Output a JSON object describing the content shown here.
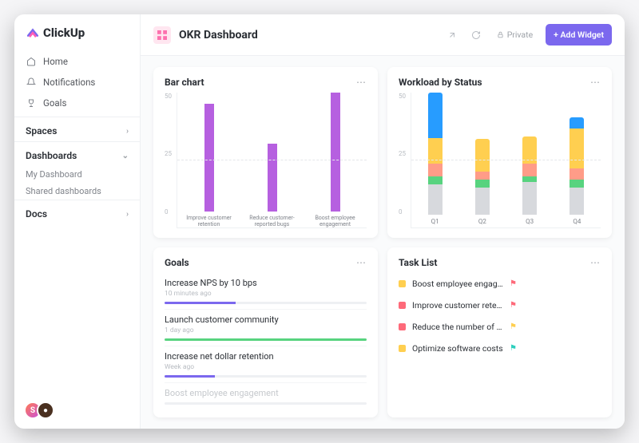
{
  "brand": "ClickUp",
  "sidebar": {
    "home": "Home",
    "notifications": "Notifications",
    "goals": "Goals",
    "spaces": {
      "label": "Spaces"
    },
    "dashboards": {
      "label": "Dashboards",
      "items": [
        "My Dashboard",
        "Shared dashboards"
      ]
    },
    "docs": {
      "label": "Docs"
    }
  },
  "header": {
    "title": "OKR Dashboard",
    "private": "Private",
    "add_widget": "+ Add Widget"
  },
  "cards": {
    "bar_chart": {
      "title": "Bar chart"
    },
    "workload": {
      "title": "Workload by Status"
    },
    "goals": {
      "title": "Goals",
      "items": [
        {
          "title": "Increase NPS by 10 bps",
          "sub": "10 minutes ago",
          "pct": 35,
          "color": "#7b68ee"
        },
        {
          "title": "Launch customer community",
          "sub": "1 day ago",
          "pct": 100,
          "color": "#58d37f"
        },
        {
          "title": "Increase net dollar retention",
          "sub": "Week ago",
          "pct": 25,
          "color": "#7b68ee"
        },
        {
          "title": "Boost employee engagement",
          "sub": "",
          "pct": 0,
          "color": "#c6c9cd",
          "faded": true
        }
      ]
    },
    "tasklist": {
      "title": "Task List",
      "items": [
        {
          "color": "#ffcf50",
          "label": "Boost employee engagement",
          "flag": "#fe6a7a"
        },
        {
          "color": "#fe6a7a",
          "label": "Improve customer retention and…",
          "flag": "#fe6a7a"
        },
        {
          "color": "#fe6a7a",
          "label": "Reduce the number of Customer…",
          "flag": "#ffcf50"
        },
        {
          "color": "#ffcf50",
          "label": "Optimize software costs",
          "flag": "#2ecfbd"
        }
      ]
    }
  },
  "chart_data": [
    {
      "type": "bar",
      "title": "Bar chart",
      "categories": [
        "Improve customer retention",
        "Reduce customer-reported bugs",
        "Boost employee engagement"
      ],
      "values": [
        40,
        25,
        45
      ],
      "ylim": [
        0,
        50
      ],
      "yticks": [
        0,
        25,
        50
      ],
      "color": "#b660e0"
    },
    {
      "type": "bar",
      "title": "Workload by Status",
      "stacked": true,
      "categories": [
        "Q1",
        "Q2",
        "Q3",
        "Q4"
      ],
      "series": [
        {
          "name": "grey",
          "color": "#d7d9dd",
          "values": [
            12,
            10,
            12,
            10
          ]
        },
        {
          "name": "green",
          "color": "#58d37f",
          "values": [
            3,
            3,
            2,
            3
          ]
        },
        {
          "name": "salmon",
          "color": "#ff9c88",
          "values": [
            5,
            3,
            5,
            4
          ]
        },
        {
          "name": "yellow",
          "color": "#ffcf50",
          "values": [
            10,
            12,
            10,
            15
          ]
        },
        {
          "name": "blue",
          "color": "#279cff",
          "values": [
            18,
            0,
            0,
            4
          ]
        }
      ],
      "ylim": [
        0,
        50
      ],
      "yticks": [
        0,
        25,
        50
      ]
    }
  ]
}
